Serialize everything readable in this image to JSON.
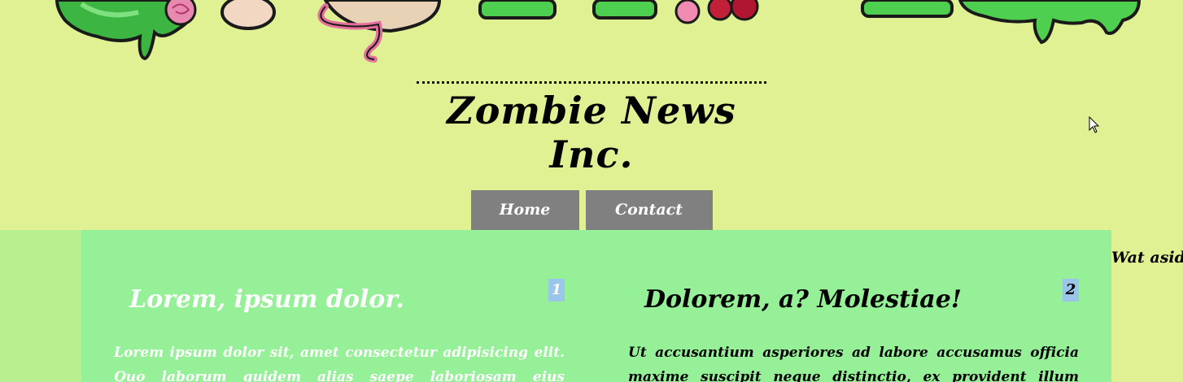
{
  "header": {
    "site_title": "Zombie News Inc."
  },
  "nav": {
    "home_label": "Home",
    "contact_label": "Contact"
  },
  "aside": {
    "text": "Wat aside"
  },
  "articles": [
    {
      "number": "1",
      "title": "Lorem, ipsum dolor.",
      "body": "Lorem ipsum dolor sit, amet consectetur adipisicing elit. Quo laborum quidem alias saepe laboriosam eius"
    },
    {
      "number": "2",
      "title": "Dolorem, a? Molestiae!",
      "body": "Ut accusantium asperiores ad labore accusamus officia maxime suscipit neque distinctio, ex provident illum"
    }
  ],
  "colors": {
    "page_bg": "#dff192",
    "main_bg": "#95f097",
    "nav_bg": "#808080",
    "badge_bg": "#9ac6ea"
  },
  "icons": [
    "zombie-banner-illustration",
    "mouse-cursor-icon"
  ]
}
